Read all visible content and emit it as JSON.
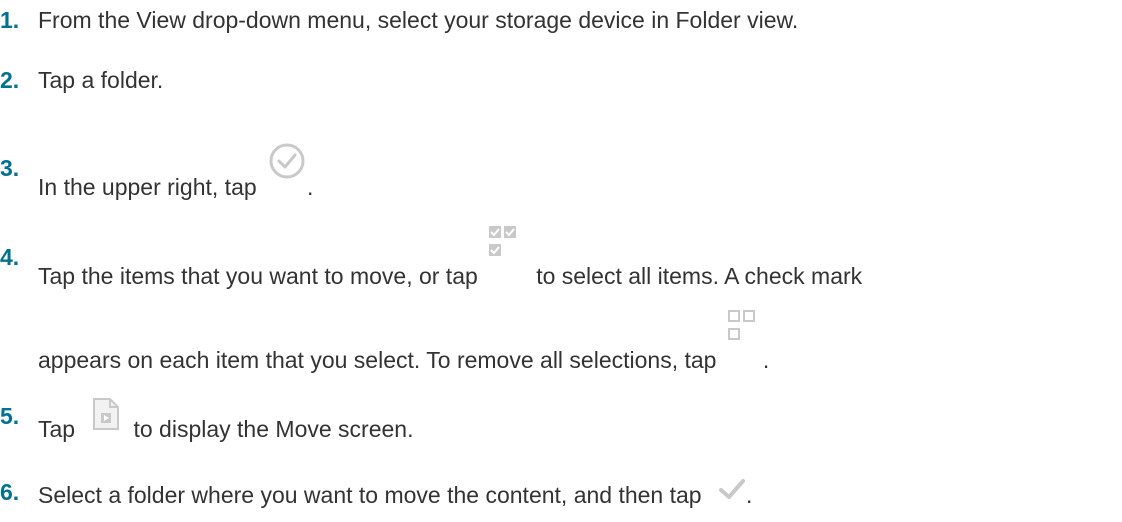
{
  "steps": [
    {
      "number": "1.",
      "text": "From the View drop-down menu, select your storage device in Folder view."
    },
    {
      "number": "2.",
      "text": "Tap a folder."
    },
    {
      "number": "3.",
      "before": "In the upper right, tap",
      "icon": "select-circle-check-icon",
      "after": "."
    },
    {
      "number": "4.",
      "before": "Tap the items that you want to move, or tap",
      "icon": "select-all-icon",
      "after": "to select all items. A check mark",
      "line2_before": "appears on each item that you select. To remove all selections, tap",
      "icon2": "deselect-all-icon",
      "line2_after": "."
    },
    {
      "number": "5.",
      "before": "Tap",
      "icon": "move-document-icon",
      "after": "to display the Move screen."
    },
    {
      "number": "6.",
      "before": "Select a folder where you want to move the content, and then tap",
      "icon": "checkmark-icon",
      "after": "."
    }
  ],
  "colors": {
    "step_number": "#00718f",
    "body_text": "#333333",
    "icon_gray": "#c9c9c9"
  }
}
